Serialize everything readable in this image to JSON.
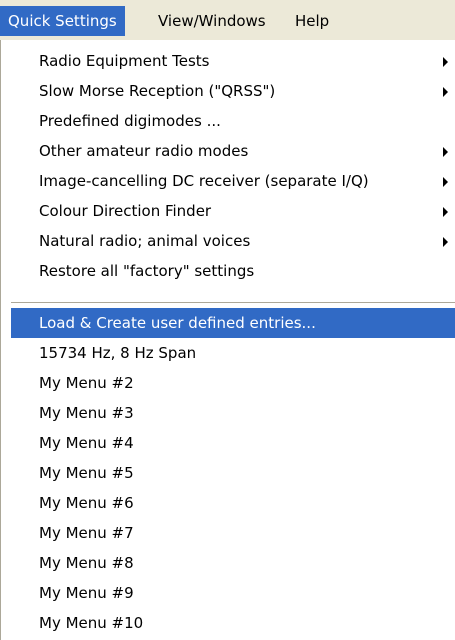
{
  "menubar": {
    "items": [
      {
        "label": "Quick Settings"
      },
      {
        "label": "View/Windows"
      },
      {
        "label": "Help"
      }
    ]
  },
  "menu": {
    "group1": [
      {
        "label": "Radio Equipment Tests",
        "submenu": true
      },
      {
        "label": "Slow Morse Reception (\"QRSS\")",
        "submenu": true
      },
      {
        "label": "Predefined digimodes ...",
        "submenu": false
      },
      {
        "label": "Other amateur radio modes",
        "submenu": true
      },
      {
        "label": "Image-cancelling DC receiver (separate I/Q)",
        "submenu": true
      },
      {
        "label": "Colour Direction Finder",
        "submenu": true
      },
      {
        "label": "Natural radio;  animal voices",
        "submenu": true
      },
      {
        "label": "Restore all \"factory\" settings",
        "submenu": false
      }
    ],
    "group2": [
      {
        "label": "Load & Create user defined entries..."
      },
      {
        "label": "15734 Hz, 8 Hz Span"
      },
      {
        "label": "My Menu #2"
      },
      {
        "label": "My Menu #3"
      },
      {
        "label": "My Menu #4"
      },
      {
        "label": "My Menu #5"
      },
      {
        "label": "My Menu #6"
      },
      {
        "label": "My Menu #7"
      },
      {
        "label": "My Menu #8"
      },
      {
        "label": "My Menu #9"
      },
      {
        "label": "My Menu #10"
      }
    ]
  },
  "colors": {
    "menubar_bg": "#ece9d8",
    "highlight": "#316ac5",
    "highlight_text": "#ffffff"
  }
}
